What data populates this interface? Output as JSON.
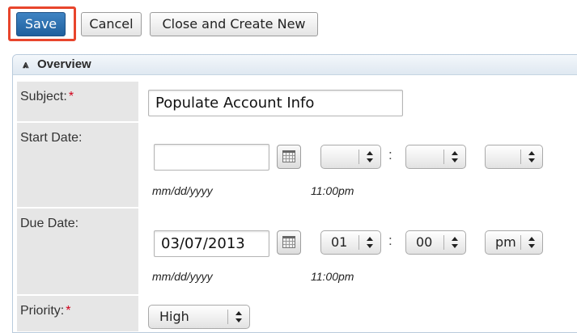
{
  "toolbar": {
    "save_label": "Save",
    "cancel_label": "Cancel",
    "close_create_label": "Close and Create New",
    "highlight_color": "#e8452c"
  },
  "panel": {
    "title": "Overview",
    "collapse_icon": "double-chevron-up-icon"
  },
  "fields": {
    "subject": {
      "label": "Subject:",
      "required_mark": "*",
      "value": "Populate Account Info"
    },
    "start_date": {
      "label": "Start Date:",
      "date_value": "",
      "hour": "",
      "minute": "",
      "meridiem": "",
      "colon": ":",
      "date_hint": "mm/dd/yyyy",
      "time_hint": "11:00pm"
    },
    "due_date": {
      "label": "Due Date:",
      "date_value": "03/07/2013",
      "hour": "01",
      "minute": "00",
      "meridiem": "pm",
      "colon": ":",
      "date_hint": "mm/dd/yyyy",
      "time_hint": "11:00pm"
    },
    "priority": {
      "label": "Priority:",
      "required_mark": "*",
      "value": "High"
    }
  },
  "colors": {
    "primary_button": "#2a6fb0",
    "required": "#d0021b",
    "label_background": "#e6e6e6"
  }
}
